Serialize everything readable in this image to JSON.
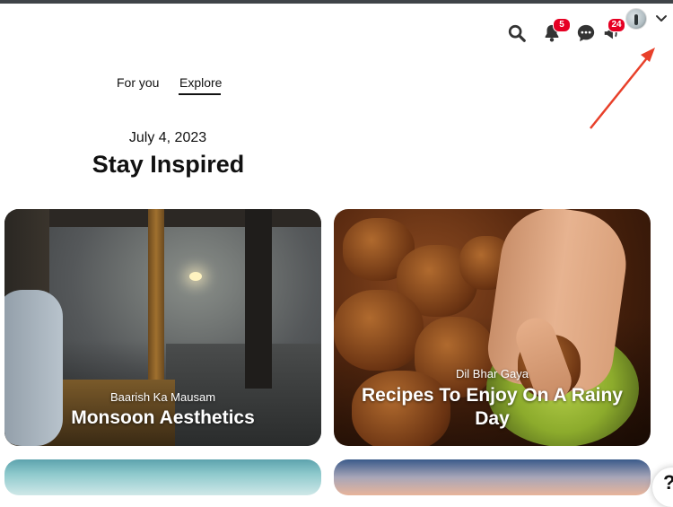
{
  "header": {
    "notifications_count": "5",
    "messages_count": "24",
    "icons": [
      "search-icon",
      "bell-icon",
      "chat-icon",
      "megaphone-icon",
      "avatar",
      "chevron-down-icon"
    ]
  },
  "tabs": [
    {
      "label": "For you",
      "active": false
    },
    {
      "label": "Explore",
      "active": true
    }
  ],
  "hero": {
    "date": "July 4, 2023",
    "title": "Stay Inspired"
  },
  "cards": [
    {
      "subtitle": "Baarish Ka Mausam",
      "title": "Monsoon Aesthetics"
    },
    {
      "subtitle": "Dil Bhar Gaya",
      "title": "Recipes To Enjoy On A Rainy Day"
    }
  ],
  "help": {
    "label": "?"
  },
  "colors": {
    "badge": "#e60023",
    "annotation_arrow": "#e8402a"
  }
}
